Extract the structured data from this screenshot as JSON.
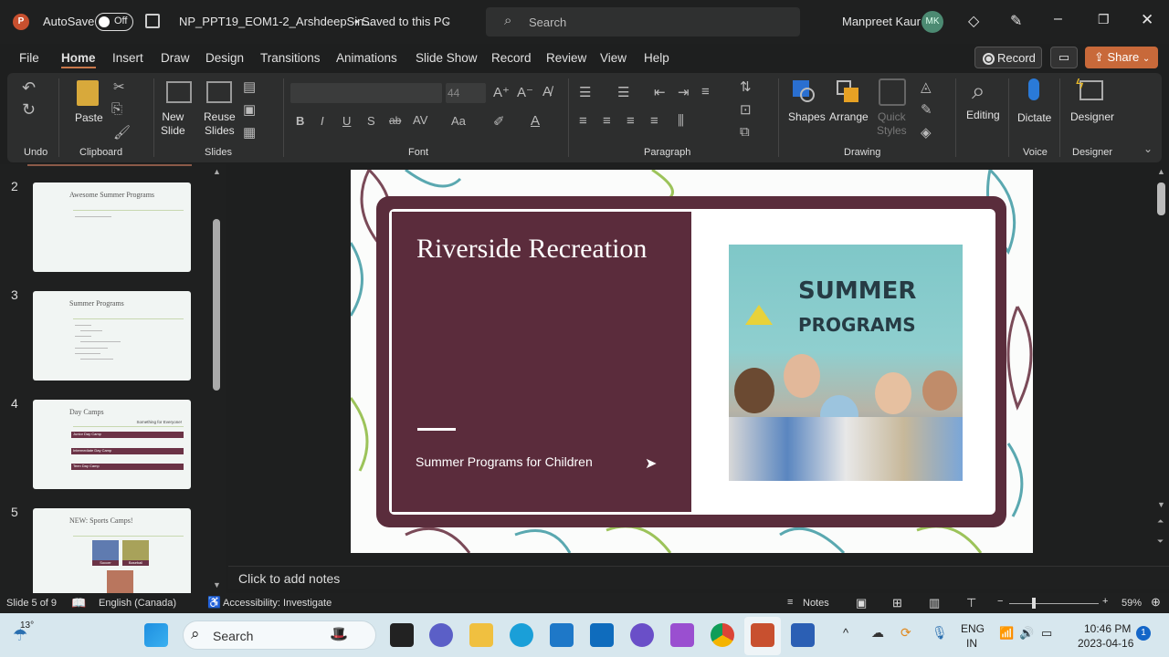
{
  "titlebar": {
    "autosave_label": "AutoSave",
    "toggle_state": "Off",
    "filename": "NP_PPT19_EOM1-2_ArshdeepSin...",
    "save_status": "• Saved to this PC",
    "search_placeholder": "Search",
    "user_name": "Manpreet Kaur",
    "user_initials": "MK"
  },
  "menu": {
    "tabs": [
      "File",
      "Home",
      "Insert",
      "Draw",
      "Design",
      "Transitions",
      "Animations",
      "Slide Show",
      "Record",
      "Review",
      "View",
      "Help"
    ],
    "active": "Home",
    "record_label": "Record",
    "share_label": "Share"
  },
  "ribbon": {
    "undo_group": "Undo",
    "paste": "Paste",
    "clipboard_group": "Clipboard",
    "new_slide": [
      "New",
      "Slide"
    ],
    "reuse_slides": [
      "Reuse",
      "Slides"
    ],
    "slides_group": "Slides",
    "font_size": "44",
    "font_group": "Font",
    "paragraph_group": "Paragraph",
    "shapes": "Shapes",
    "arrange": "Arrange",
    "quick_styles": [
      "Quick",
      "Styles"
    ],
    "drawing_group": "Drawing",
    "editing": "Editing",
    "dictate": "Dictate",
    "voice_group": "Voice",
    "designer": "Designer",
    "designer_group": "Designer",
    "font_buttons": [
      "B",
      "I",
      "U",
      "S",
      "ab",
      "AV",
      "Aa",
      "A"
    ]
  },
  "thumbnails": [
    {
      "number": "2",
      "title": "Awesome Summer Programs"
    },
    {
      "number": "3",
      "title": "Summer Programs"
    },
    {
      "number": "4",
      "title": "Day Camps",
      "subtitle": "Something for Everyone!",
      "bars": [
        "Junior Day Camp",
        "Intermediate Day Camp",
        "Teen Day Camp"
      ]
    },
    {
      "number": "5",
      "title": "NEW: Sports Camps!",
      "captions": [
        "Soccer",
        "Baseball"
      ]
    }
  ],
  "slide": {
    "title": "Riverside Recreation",
    "subtitle": "Summer Programs for Children",
    "image_text": [
      "SUMMER",
      "PROGRAMS"
    ],
    "colors": {
      "maroon": "#5b2c3c",
      "white": "#ffffff"
    }
  },
  "notes": {
    "placeholder": "Click to add notes"
  },
  "statusbar": {
    "slide_position": "Slide 5 of 9",
    "language": "English (Canada)",
    "accessibility": "Accessibility: Investigate",
    "notes_label": "Notes",
    "zoom": "59%",
    "zoom_percent": 59
  },
  "taskbar": {
    "weather": "13°",
    "search_placeholder": "Search",
    "lang": [
      "ENG",
      "IN"
    ],
    "time": "10:46 PM",
    "date": "2023-04-16",
    "notification_count": "1"
  }
}
